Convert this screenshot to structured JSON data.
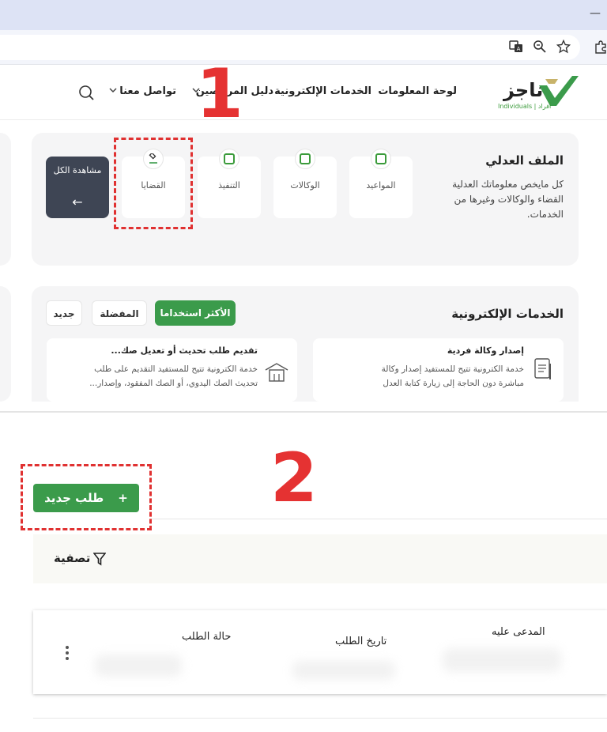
{
  "browser": {
    "minimize_glyph": "—",
    "toolbar_icons": [
      "translate-icon",
      "zoom-icon",
      "star-icon",
      "extensions-icon"
    ]
  },
  "header": {
    "logo_text": "ناجز",
    "logo_sub": "Individuals | أفراد",
    "nav": [
      {
        "label": "لوحة المعلومات"
      },
      {
        "label": "الخدمات الإلكترونية"
      },
      {
        "label": "دليل المرخصين"
      },
      {
        "label": "تواصل معنا"
      }
    ]
  },
  "judicial_file": {
    "title": "الملف العدلي",
    "description": "كل مايخص معلوماتك العدلية القضاء والوكالات وغيرها من الخدمات.",
    "cards": [
      {
        "label": "المواعيد"
      },
      {
        "label": "الوكالات"
      },
      {
        "label": "التنفيذ"
      },
      {
        "label": "القضايا"
      }
    ],
    "view_all_label": "مشاهدة الكل",
    "view_all_arrow": "←"
  },
  "eservices": {
    "title": "الخدمات الإلكترونية",
    "tabs": [
      {
        "label": "الأكثر استخداما",
        "active": true
      },
      {
        "label": "المفضلة",
        "active": false
      },
      {
        "label": "جديد",
        "active": false
      }
    ],
    "items": [
      {
        "title": "إصدار وكالة فردية",
        "description": "خدمة الكترونية تتيح للمستفيد إصدار وكالة مباشرة دون الحاجة إلى زيارة كتابة العدل"
      },
      {
        "title": "تقديم طلب تحديث أو تعديل صك...",
        "description": "خدمة الكترونية تتيح للمستفيد التقديم على طلب تحديث الصك اليدوي، أو الصك المفقود، وإصدار..."
      }
    ]
  },
  "annotations": {
    "step1": "1",
    "step2": "2"
  },
  "requests": {
    "new_button_label": "طلب جديد",
    "new_button_plus": "+",
    "filter_label": "تصفية",
    "columns": [
      "المدعى عليه",
      "تاريخ الطلب",
      "حالة الطلب"
    ],
    "kebab": "⋮"
  },
  "colors": {
    "brand_green": "#3b9b4b",
    "dark_button": "#3e4554",
    "annotation_red": "#e53232"
  }
}
